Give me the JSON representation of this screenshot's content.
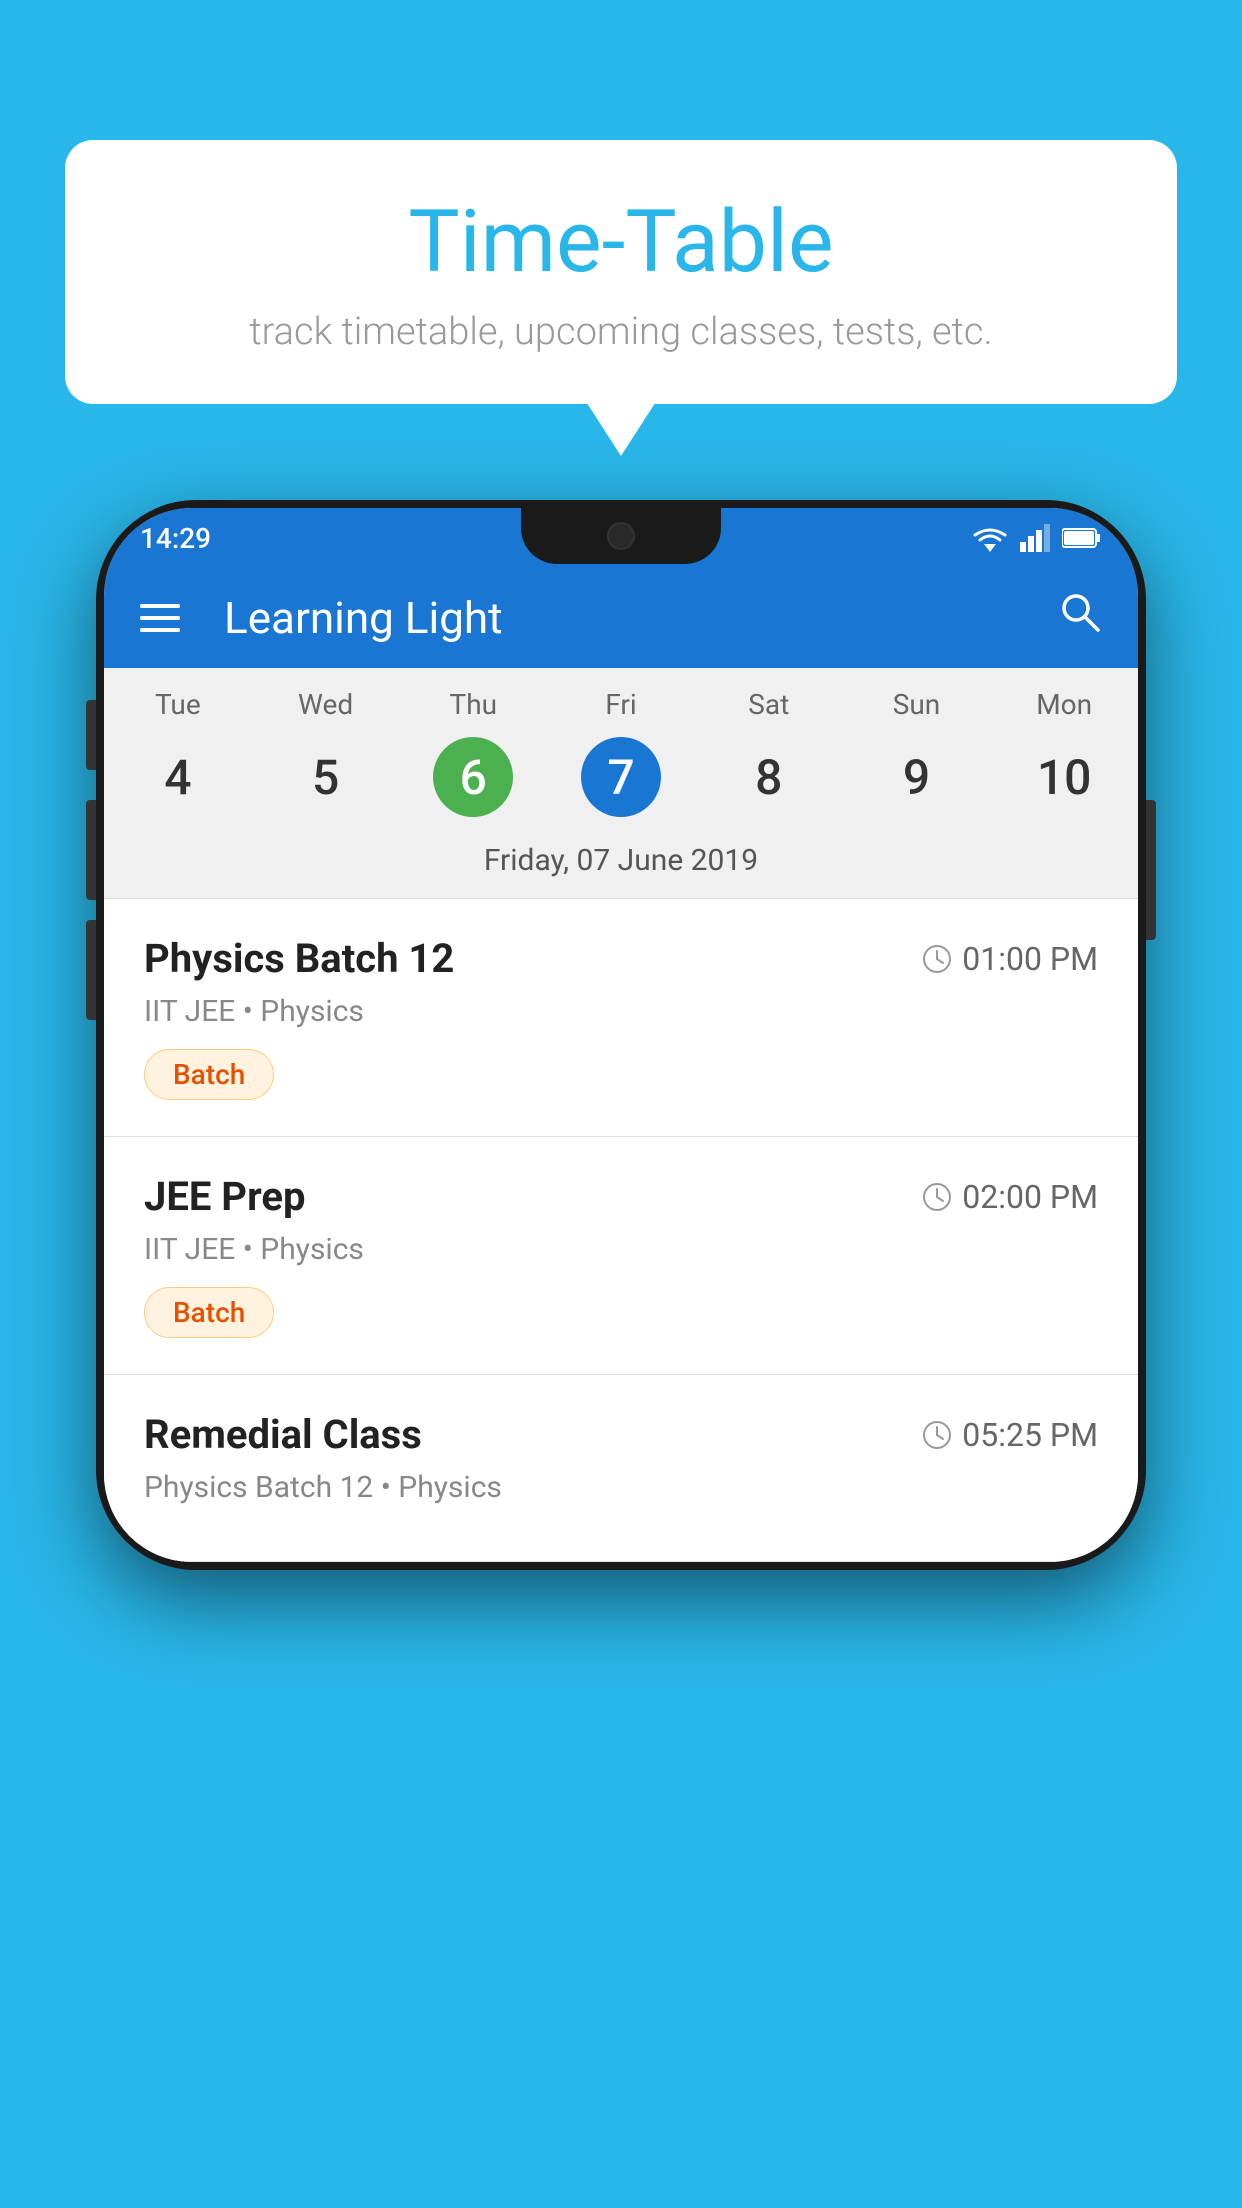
{
  "background": {
    "color": "#29B6E8"
  },
  "speech_bubble": {
    "title": "Time-Table",
    "subtitle": "track timetable, upcoming classes, tests, etc."
  },
  "phone": {
    "status_bar": {
      "time": "14:29"
    },
    "app_bar": {
      "title": "Learning Light"
    },
    "calendar": {
      "days": [
        {
          "name": "Tue",
          "num": "4",
          "state": "normal"
        },
        {
          "name": "Wed",
          "num": "5",
          "state": "normal"
        },
        {
          "name": "Thu",
          "num": "6",
          "state": "today"
        },
        {
          "name": "Fri",
          "num": "7",
          "state": "selected"
        },
        {
          "name": "Sat",
          "num": "8",
          "state": "normal"
        },
        {
          "name": "Sun",
          "num": "9",
          "state": "normal"
        },
        {
          "name": "Mon",
          "num": "10",
          "state": "normal"
        }
      ],
      "selected_date_label": "Friday, 07 June 2019"
    },
    "schedule": {
      "items": [
        {
          "title": "Physics Batch 12",
          "time": "01:00 PM",
          "subtitle": "IIT JEE • Physics",
          "tag": "Batch"
        },
        {
          "title": "JEE Prep",
          "time": "02:00 PM",
          "subtitle": "IIT JEE • Physics",
          "tag": "Batch"
        },
        {
          "title": "Remedial Class",
          "time": "05:25 PM",
          "subtitle": "Physics Batch 12 • Physics",
          "tag": ""
        }
      ]
    }
  }
}
